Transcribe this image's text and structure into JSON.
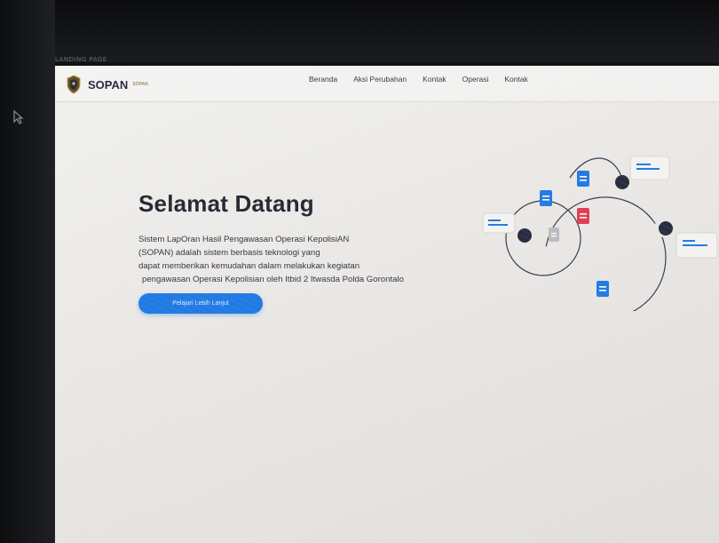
{
  "frame": {
    "label": "LANDING PAGE"
  },
  "brand": {
    "name": "SOPAN",
    "sub": "SOPAN"
  },
  "nav": {
    "items": [
      "Beranda",
      "Aksi Perubahan",
      "Kontak",
      "Operasi",
      "Kontak"
    ]
  },
  "hero": {
    "title": "Selamat Datang",
    "description_lines": [
      "Sistem LapOran Hasil Pengawasan Operasi KepolisiAN",
      "(SOPAN) adalah sistem berbasis teknologi yang",
      "dapat memberikan kemudahan dalam melakukan kegiatan",
      "pengawasan Operasi Kepolisian oleh Itbid 2 Itwasda Polda Gorontalo"
    ],
    "cta_label": "Pelajari Lebih Lanjut"
  },
  "colors": {
    "accent": "#1877e6",
    "doc_red": "#e2364b",
    "node_dark": "#1f2438",
    "text_dark": "#1c1f2a"
  },
  "icons": [
    "cursor-icon",
    "police-shield-logo-icon",
    "document-icon",
    "chat-bubble-icon",
    "node-dot-icon"
  ]
}
